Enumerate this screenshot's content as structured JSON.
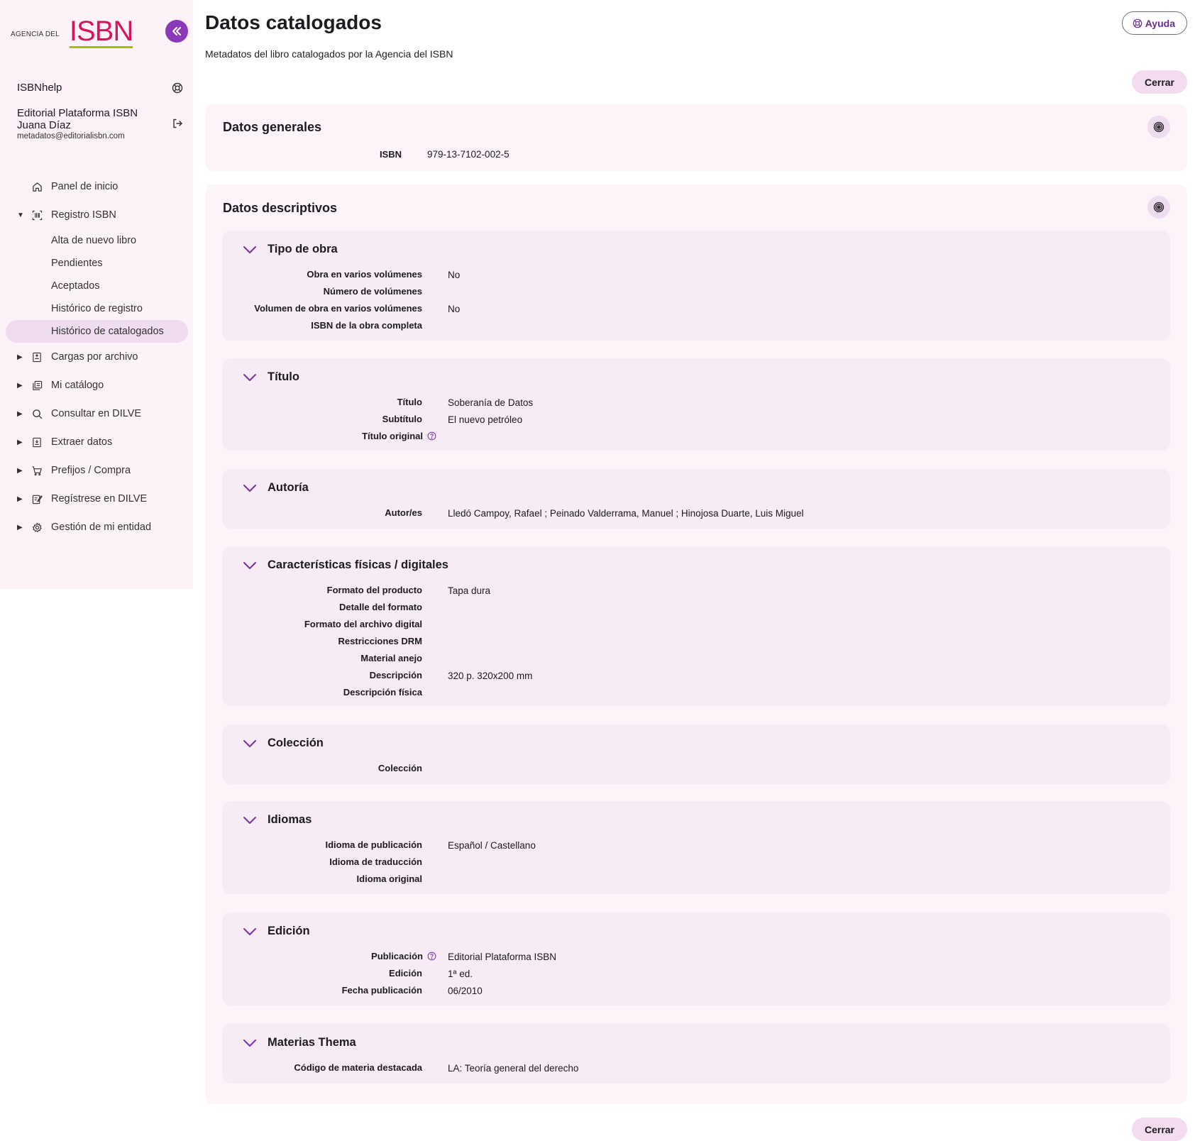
{
  "sidebar": {
    "logo_small": "AGENCIA DEL",
    "logo_main": "ISBN",
    "help_label": "ISBNhelp",
    "user": {
      "org": "Editorial Plataforma ISBN",
      "name": "Juana Díaz",
      "email": "metadatos@editorialisbn.com"
    },
    "nav": {
      "panel": "Panel de inicio",
      "registro": "Registro ISBN",
      "registro_sub": [
        "Alta de nuevo libro",
        "Pendientes",
        "Aceptados",
        "Histórico de registro",
        "Histórico de catalogados"
      ],
      "cargas": "Cargas por archivo",
      "catalogo": "Mi catálogo",
      "consultar": "Consultar en DILVE",
      "extraer": "Extraer datos",
      "prefijos": "Prefijos / Compra",
      "registrese": "Regístrese en DILVE",
      "gestion": "Gestión de mi entidad"
    }
  },
  "header": {
    "title": "Datos catalogados",
    "subtitle": "Metadatos del libro catalogados por la Agencia del ISBN",
    "help_button": "Ayuda",
    "close_button": "Cerrar"
  },
  "generales": {
    "title": "Datos generales",
    "isbn_label": "ISBN",
    "isbn_value": "979-13-7102-002-5"
  },
  "descriptivos": {
    "title": "Datos descriptivos",
    "tipo_obra": {
      "title": "Tipo de obra",
      "rows": [
        {
          "label": "Obra en varios volúmenes",
          "value": "No"
        },
        {
          "label": "Número de volúmenes",
          "value": ""
        },
        {
          "label": "Volumen de obra en varios volúmenes",
          "value": "No"
        },
        {
          "label": "ISBN de la obra completa",
          "value": ""
        }
      ]
    },
    "titulo": {
      "title": "Título",
      "rows": [
        {
          "label": "Título",
          "value": "Soberanía de Datos"
        },
        {
          "label": "Subtítulo",
          "value": "El nuevo petróleo"
        },
        {
          "label": "Título original",
          "value": ""
        }
      ]
    },
    "autoria": {
      "title": "Autoría",
      "rows": [
        {
          "label": "Autor/es",
          "value": "Lledó Campoy, Rafael ; Peinado Valderrama, Manuel ; Hinojosa Duarte, Luis Miguel"
        }
      ]
    },
    "caracteristicas": {
      "title": "Características físicas / digitales",
      "rows": [
        {
          "label": "Formato del producto",
          "value": "Tapa dura"
        },
        {
          "label": "Detalle del formato",
          "value": ""
        },
        {
          "label": "Formato del archivo digital",
          "value": ""
        },
        {
          "label": "Restricciones DRM",
          "value": ""
        },
        {
          "label": "Material anejo",
          "value": ""
        },
        {
          "label": "Descripción",
          "value": "320 p. 320x200 mm"
        },
        {
          "label": "Descripción física",
          "value": ""
        }
      ]
    },
    "coleccion": {
      "title": "Colección",
      "rows": [
        {
          "label": "Colección",
          "value": ""
        }
      ]
    },
    "idiomas": {
      "title": "Idiomas",
      "rows": [
        {
          "label": "Idioma de publicación",
          "value": "Español / Castellano"
        },
        {
          "label": "Idioma de traducción",
          "value": ""
        },
        {
          "label": "Idioma original",
          "value": ""
        }
      ]
    },
    "edicion": {
      "title": "Edición",
      "rows": [
        {
          "label": "Publicación",
          "value": "Editorial Plataforma ISBN"
        },
        {
          "label": "Edición",
          "value": "1ª ed."
        },
        {
          "label": "Fecha publicación",
          "value": "06/2010"
        }
      ]
    },
    "materias": {
      "title": "Materias Thema",
      "rows": [
        {
          "label": "Código de materia destacada",
          "value": "LA: Teoría general del derecho"
        }
      ]
    }
  },
  "colors": {
    "accent": "#8a3ab9",
    "brand": "#d6145f",
    "brand_underline": "#a2c200",
    "sidebar_bg": "#fdf2f8",
    "card_bg": "#fdf4fa",
    "section_bg": "#f7ebf5"
  }
}
